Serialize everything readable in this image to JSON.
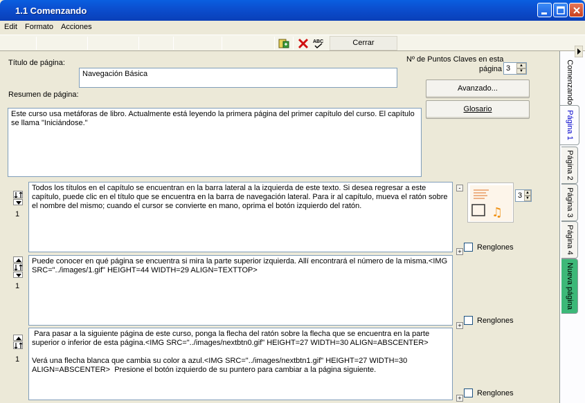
{
  "window": {
    "title": "1.1 Comenzando"
  },
  "menu": [
    "Edit",
    "Formato",
    "Acciones"
  ],
  "toolbar": {
    "close_label": "Cerrar"
  },
  "form": {
    "page_title_label": "Título de página:",
    "page_title_value": "Navegación Básica",
    "summary_label": "Resumen de página:",
    "summary_value": "Este curso usa metáforas de libro. Actualmente está leyendo la primera página del primer capítulo del curso. El capítulo se llama \"Iniciándose.\"",
    "keypoints_label_line1": "Nº de Puntos Claves en esta",
    "keypoints_label_line2": "página",
    "keypoints_value": "3",
    "advanced_button": "Avanzado...",
    "glossary_button": "Glosario"
  },
  "points": [
    {
      "number": "1",
      "text": "Todos los títulos en el capítulo se encuentran en la barra lateral a la izquierda de este texto. Si desea regresar a este capítulo, puede clic en el título que se encuentra en la barra de navegación lateral. Para ir al capítulo, mueva el ratón sobre el nombre del mismo; cuando el cursor se convierte en mano, oprima el botón izquierdo del ratón.",
      "lines_label": "Renglones"
    },
    {
      "number": "1",
      "text": "Puede conocer en qué página se encuentra si mira la parte superior izquierda. Allí encontrará el número de la misma.<IMG SRC=\"../images/1.gif\" HEIGHT=44 WIDTH=29 ALIGN=TEXTTOP>",
      "lines_label": "Renglones"
    },
    {
      "number": "1",
      "text": " Para pasar a la siguiente página de este curso, ponga la flecha del ratón sobre la flecha que se encuentra en la parte superior o inferior de esta página.<IMG SRC=\"../images/nextbtn0.gif\" HEIGHT=27 WIDTH=30 ALIGN=ABSCENTER>\n\nVerá una flecha blanca que cambia su color a azul.<IMG SRC=\"../images/nextbtn1.gif\" HEIGHT=27 WIDTH=30 ALIGN=ABSCENTER>  Presione el botón izquierdo de su puntero para cambiar a la página siguiente.",
      "lines_label": "Renglones"
    }
  ],
  "thumbnail_spin_value": "3",
  "tabs": [
    "Comenzando",
    "Página 1",
    "Página 2",
    "Página 3",
    "Página 4",
    "Nueva página"
  ],
  "colors": {
    "titlebar": "#0a4fd0",
    "active_tab_text": "#0000cc",
    "new_page_tab": "#3cb878"
  }
}
